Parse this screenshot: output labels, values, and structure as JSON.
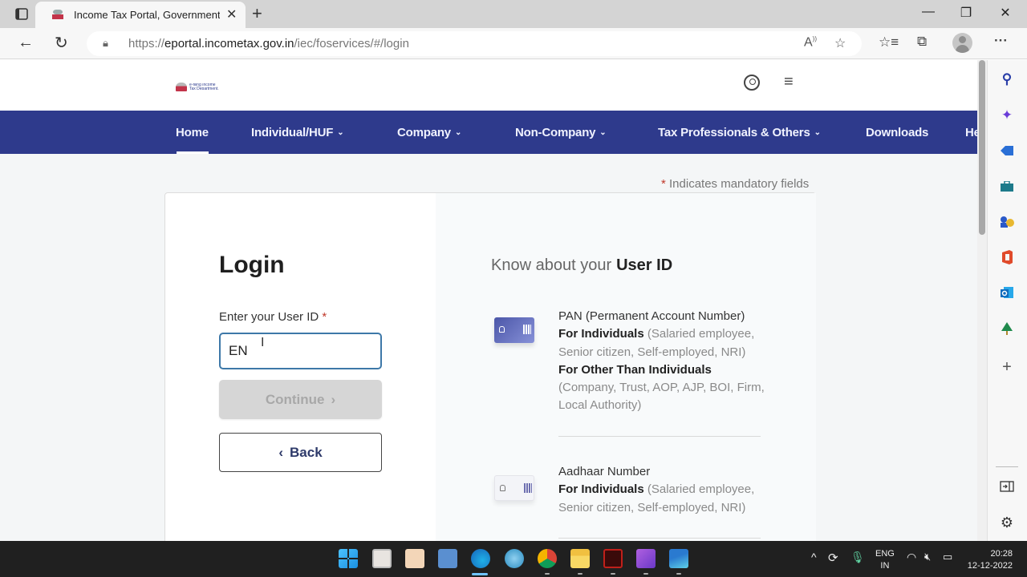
{
  "browser": {
    "tab_title": "Income Tax Portal, Government of India",
    "new_tab_symbol": "+",
    "tab_close_symbol": "✕",
    "window_controls": {
      "minimize": "—",
      "restore": "❐",
      "close": "✕"
    },
    "url_scheme": "https://",
    "url_host": "eportal.incometax.gov.in",
    "url_path": "/iec/foservices/#/login",
    "toolbar_icons": [
      "read-aloud-icon",
      "add-favorite-icon",
      "favorites-icon",
      "collections-icon",
      "profile-avatar",
      "more-menu-icon"
    ],
    "more_symbol": "···"
  },
  "site": {
    "logo_text": "e-filing Income Tax Department, Government of India",
    "nav": [
      {
        "label": "Home",
        "has_dropdown": false,
        "active": true
      },
      {
        "label": "Individual/HUF",
        "has_dropdown": true
      },
      {
        "label": "Company",
        "has_dropdown": true
      },
      {
        "label": "Non-Company",
        "has_dropdown": true
      },
      {
        "label": "Tax Professionals & Others",
        "has_dropdown": true
      },
      {
        "label": "Downloads",
        "has_dropdown": false
      },
      {
        "label": "He",
        "has_dropdown": false
      }
    ],
    "chevron": "⌄",
    "mandatory_star": "*",
    "mandatory_text": "Indicates mandatory fields"
  },
  "login": {
    "title": "Login",
    "userid_label": "Enter your User ID",
    "required_star": "*",
    "userid_value": "EN",
    "continue_label": "Continue",
    "continue_arrow": "›",
    "continue_enabled": false,
    "back_arrow": "‹",
    "back_label": "Back"
  },
  "know": {
    "title_prefix": "Know about your",
    "title_bold": "User ID",
    "items": [
      {
        "name": "PAN (Permanent Account Number)",
        "groups": [
          {
            "bold": "For Individuals",
            "text": " (Salaried employee, Senior citizen, Self-employed, NRI)"
          },
          {
            "bold": "For Other Than Individuals",
            "text": " (Company, Trust, AOP, AJP, BOI, Firm, Local Authority)"
          }
        ]
      },
      {
        "name": "Aadhaar Number",
        "groups": [
          {
            "bold": "For Individuals",
            "text": " (Salaried employee, Senior citizen, Self-employed, NRI)"
          }
        ]
      }
    ]
  },
  "edge_sidebar": {
    "icons": [
      "search-icon",
      "copilot-icon",
      "shopping-tag-icon",
      "tools-icon",
      "games-icon",
      "office-icon",
      "outlook-icon",
      "tree-icon",
      "add-icon"
    ],
    "bottom_icons": [
      "split-screen-icon",
      "settings-icon"
    ]
  },
  "taskbar": {
    "apps": [
      "start",
      "reader",
      "snipping-tool",
      "remote-desktop",
      "edge",
      "paint",
      "chrome",
      "file-explorer",
      "acrobat",
      "clipchamp",
      "photos"
    ],
    "language_line1": "ENG",
    "language_line2": "IN",
    "time": "20:28",
    "date": "12-12-2022"
  }
}
